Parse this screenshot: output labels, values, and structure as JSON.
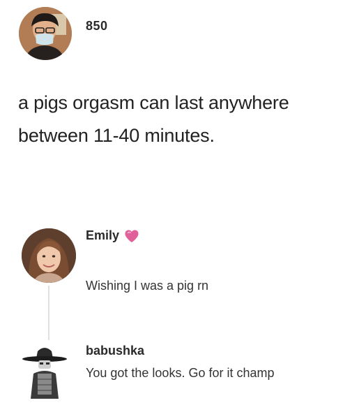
{
  "post": {
    "author": "850",
    "avatar_icon": "masked-person-avatar",
    "text": "a pigs orgasm can last anywhere between 11-40 minutes."
  },
  "replies": [
    {
      "author": "Emily",
      "badge_icon": "pink-heart-icon",
      "avatar_icon": "smiling-woman-avatar",
      "text": "Wishing I was a pig rn"
    },
    {
      "author": "babushka",
      "avatar_icon": "hooded-figure-avatar",
      "text": "You got the looks. Go for it champ"
    }
  ],
  "colors": {
    "heart": "#e0609a",
    "thread_line": "#e0e0e0"
  }
}
